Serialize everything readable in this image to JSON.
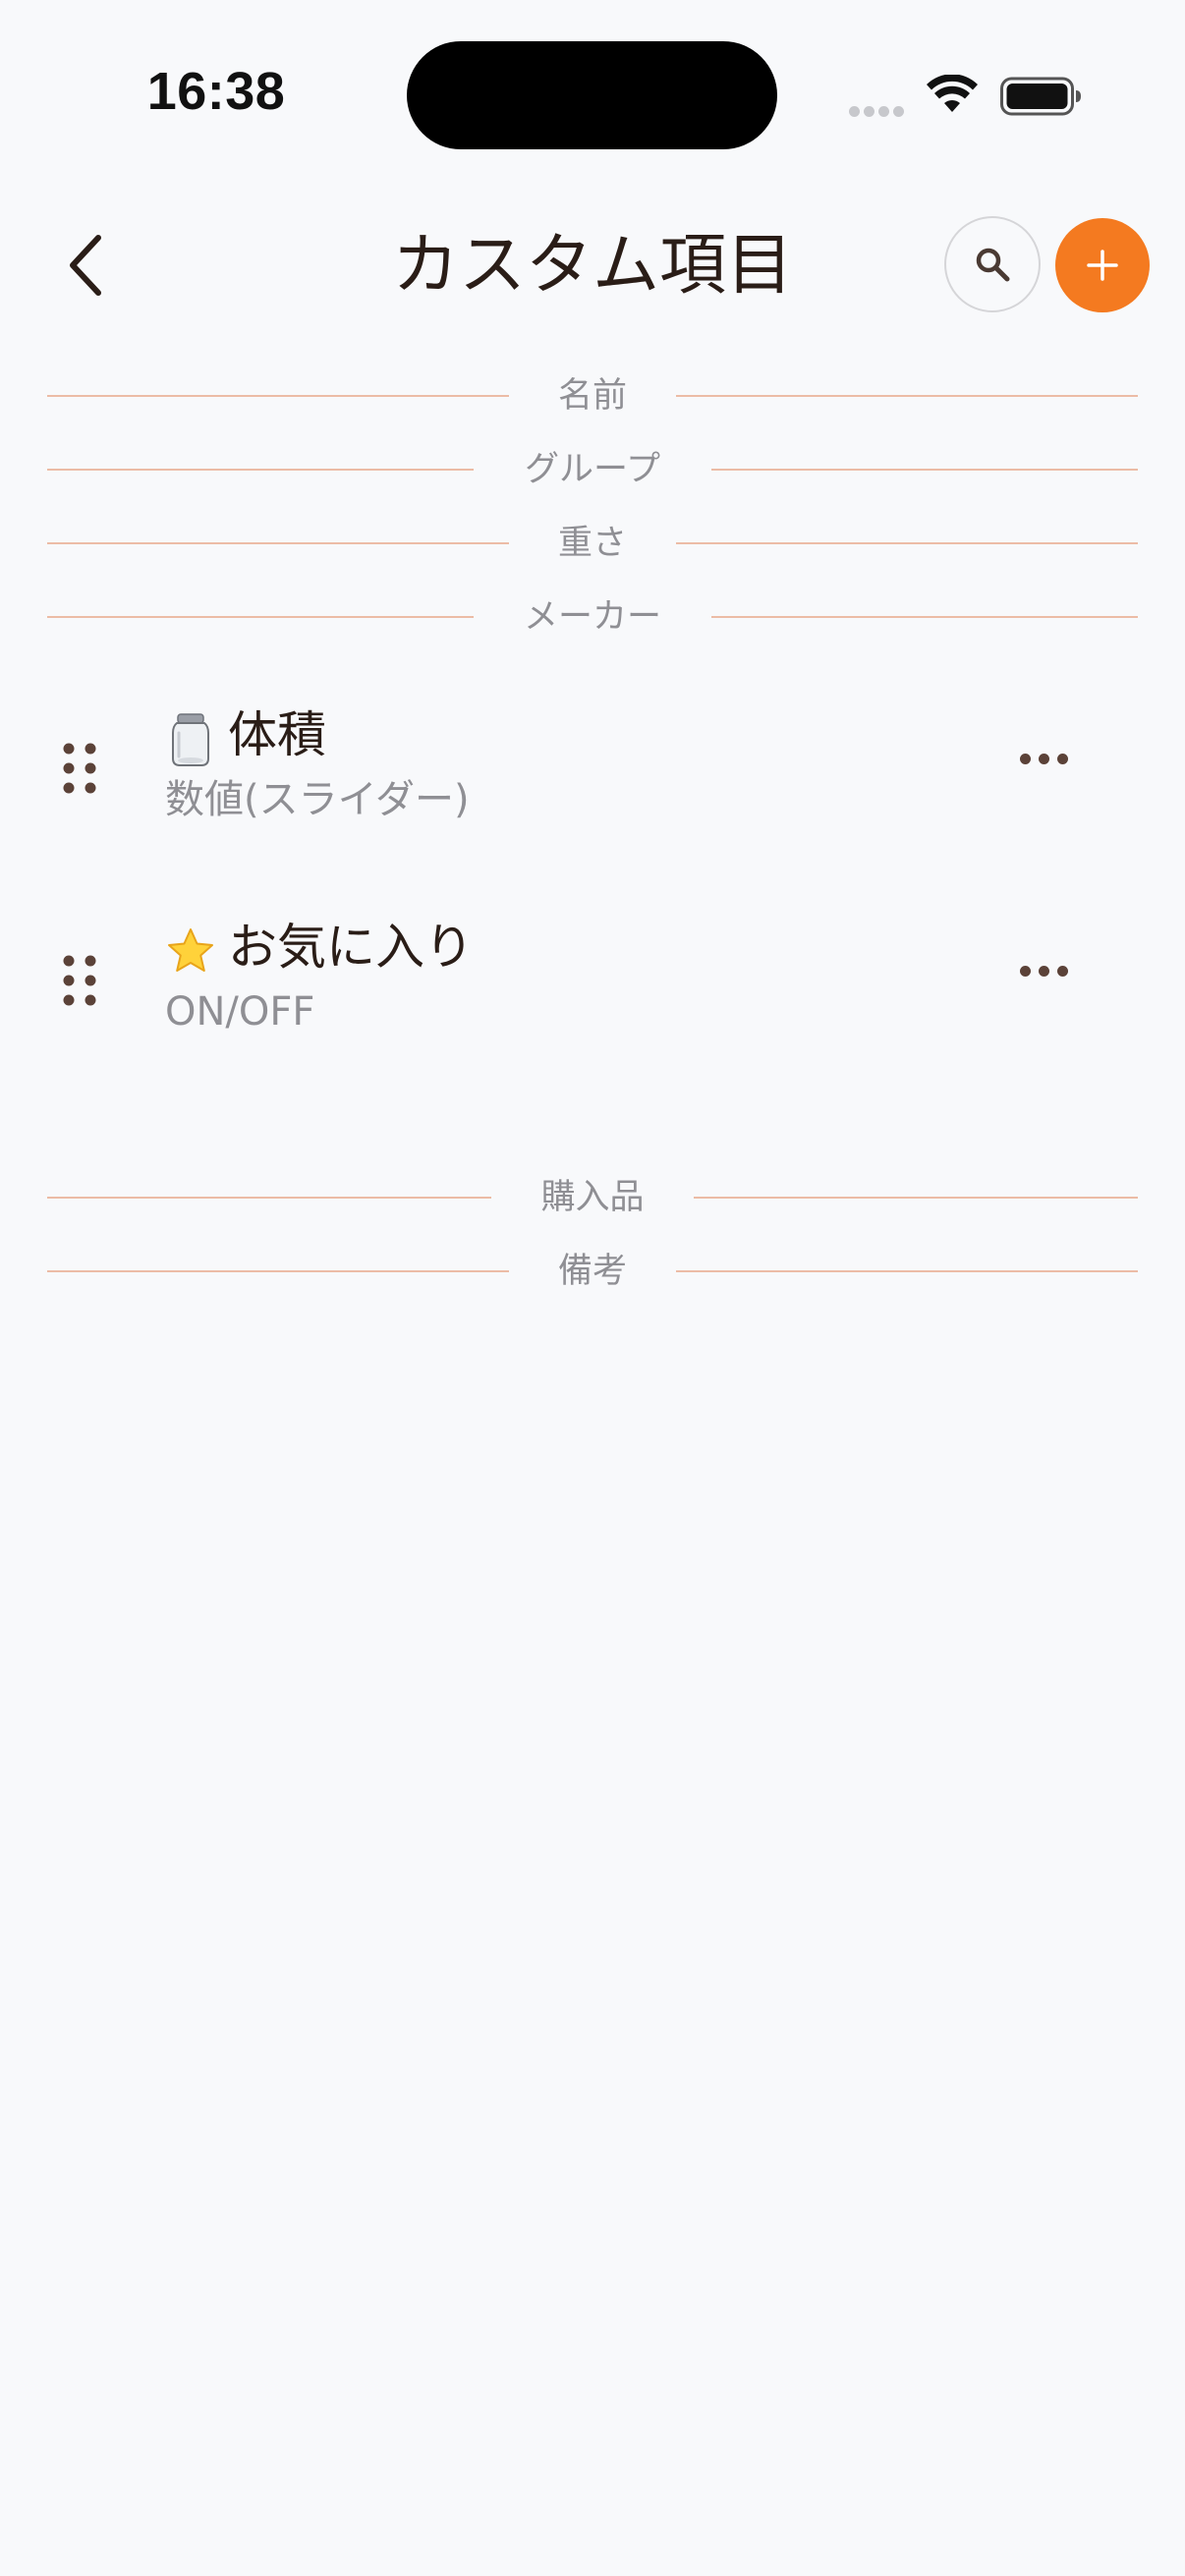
{
  "status_bar": {
    "time": "16:38"
  },
  "nav": {
    "title": "カスタム項目",
    "back_icon": "chevron-left-icon",
    "search_icon": "search-icon",
    "add_icon": "plus-icon"
  },
  "colors": {
    "accent": "#f47a20",
    "divider": "#ecbca6",
    "text_primary": "#2a1d17",
    "text_secondary": "#8f8f94",
    "handle": "#5b4238",
    "background": "#f8f9fb"
  },
  "sections_top": [
    {
      "label": "名前"
    },
    {
      "label": "グループ"
    },
    {
      "label": "重さ"
    },
    {
      "label": "メーカー"
    }
  ],
  "fields": [
    {
      "icon": "jar-icon",
      "name": "体積",
      "type": "数値(スライダー)"
    },
    {
      "icon": "star-icon",
      "name": "お気に入り",
      "type": "ON/OFF"
    }
  ],
  "sections_bottom": [
    {
      "label": "購入品"
    },
    {
      "label": "備考"
    }
  ]
}
